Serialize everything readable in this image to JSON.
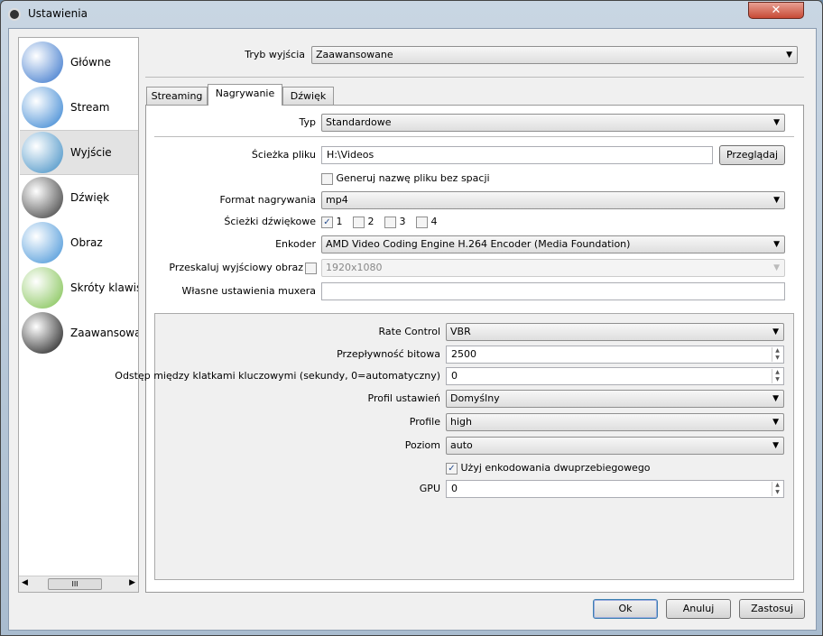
{
  "window": {
    "title": "Ustawienia",
    "close": "✕"
  },
  "sidebar": {
    "items": [
      {
        "label": "Główne",
        "icon": "monitor-wrench-icon",
        "color": "#2f6fc9"
      },
      {
        "label": "Stream",
        "icon": "globe-network-icon",
        "color": "#2e7fd0"
      },
      {
        "label": "Wyjście",
        "icon": "broadcast-icon",
        "color": "#3a8ac2",
        "selected": true
      },
      {
        "label": "Dźwięk",
        "icon": "speaker-icon",
        "color": "#333333"
      },
      {
        "label": "Obraz",
        "icon": "monitor-icon",
        "color": "#3d8fd6"
      },
      {
        "label": "Skróty klawiszowe",
        "icon": "keyboard-shortcuts-icon",
        "color": "#7bbf4a"
      },
      {
        "label": "Zaawansowane",
        "icon": "gears-icon",
        "color": "#111111"
      }
    ],
    "scroll_grip": "III"
  },
  "output_mode": {
    "label": "Tryb wyjścia",
    "value": "Zaawansowane"
  },
  "tabs": [
    {
      "label": "Streaming"
    },
    {
      "label": "Nagrywanie",
      "selected": true
    },
    {
      "label": "Dźwięk"
    }
  ],
  "recording": {
    "type": {
      "label": "Typ",
      "value": "Standardowe"
    },
    "path": {
      "label": "Ścieżka pliku",
      "value": "H:\\Videos",
      "browse": "Przeglądaj"
    },
    "no_space": {
      "label": "Generuj nazwę pliku bez spacji",
      "checked": false
    },
    "format": {
      "label": "Format nagrywania",
      "value": "mp4"
    },
    "tracks": {
      "label": "Ścieżki dźwiękowe",
      "items": [
        {
          "label": "1",
          "checked": true
        },
        {
          "label": "2",
          "checked": false
        },
        {
          "label": "3",
          "checked": false
        },
        {
          "label": "4",
          "checked": false
        }
      ]
    },
    "encoder": {
      "label": "Enkoder",
      "value": "AMD Video Coding Engine H.264 Encoder (Media Foundation)"
    },
    "rescale": {
      "label": "Przeskaluj wyjściowy obraz",
      "checked": false,
      "value": "1920x1080"
    },
    "muxer": {
      "label": "Własne ustawienia muxera",
      "value": ""
    }
  },
  "encoder_settings": {
    "rate_control": {
      "label": "Rate Control",
      "value": "VBR"
    },
    "bitrate": {
      "label": "Przepływność bitowa",
      "value": "2500"
    },
    "keyint": {
      "label": "Odstęp między klatkami kluczowymi (sekundy, 0=automatyczny)",
      "value": "0"
    },
    "preset": {
      "label": "Profil ustawień",
      "value": "Domyślny"
    },
    "profile": {
      "label": "Profile",
      "value": "high"
    },
    "level": {
      "label": "Poziom",
      "value": "auto"
    },
    "two_pass": {
      "label": "Użyj enkodowania dwuprzebiegowego",
      "checked": true
    },
    "gpu": {
      "label": "GPU",
      "value": "0"
    }
  },
  "buttons": {
    "ok": "Ok",
    "cancel": "Anuluj",
    "apply": "Zastosuj"
  }
}
